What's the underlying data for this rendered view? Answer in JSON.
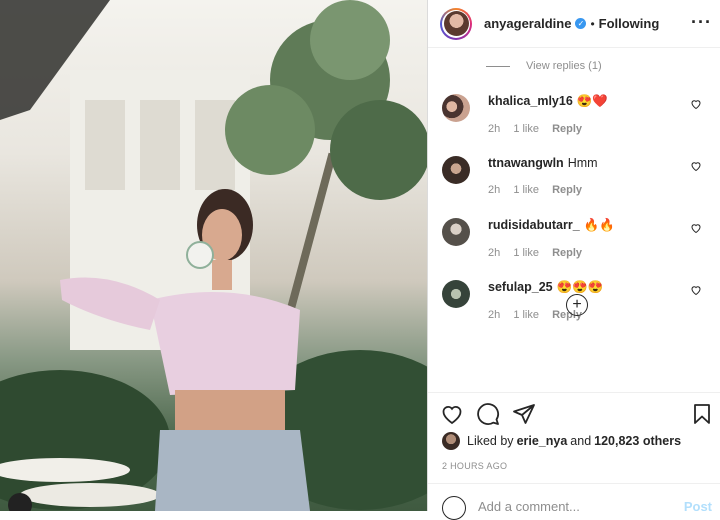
{
  "post_header": {
    "username": "anyageraldine",
    "separator": "•",
    "following_label": "Following",
    "more_icon": "ellipsis-icon"
  },
  "comments": {
    "view_replies": "View replies (1)",
    "items": [
      {
        "username": "khalica_mly16",
        "text": "😍❤️",
        "time": "2h",
        "likes": "1 like",
        "reply": "Reply"
      },
      {
        "username": "ttnawangwln",
        "text": "Hmm",
        "time": "2h",
        "likes": "1 like",
        "reply": "Reply"
      },
      {
        "username": "rudisidabutarr_",
        "text": "🔥🔥",
        "time": "2h",
        "likes": "1 like",
        "reply": "Reply"
      },
      {
        "username": "sefulap_25",
        "text": "😍😍😍",
        "time": "2h",
        "likes": "1 like",
        "reply": "Reply"
      }
    ]
  },
  "actions": {
    "like_icon": "heart-icon",
    "comment_icon": "comment-icon",
    "share_icon": "share-icon",
    "save_icon": "bookmark-icon"
  },
  "likes": {
    "prefix": "Liked by",
    "user": "erie_nya",
    "middle": "and",
    "count": "120,823 others"
  },
  "timestamp": "2 HOURS AGO",
  "add_comment": {
    "placeholder": "Add a comment...",
    "post_label": "Post"
  },
  "colors": {
    "verified": "#3897f0",
    "post_disabled": "#b2dffc",
    "muted": "#8e8e8e"
  }
}
